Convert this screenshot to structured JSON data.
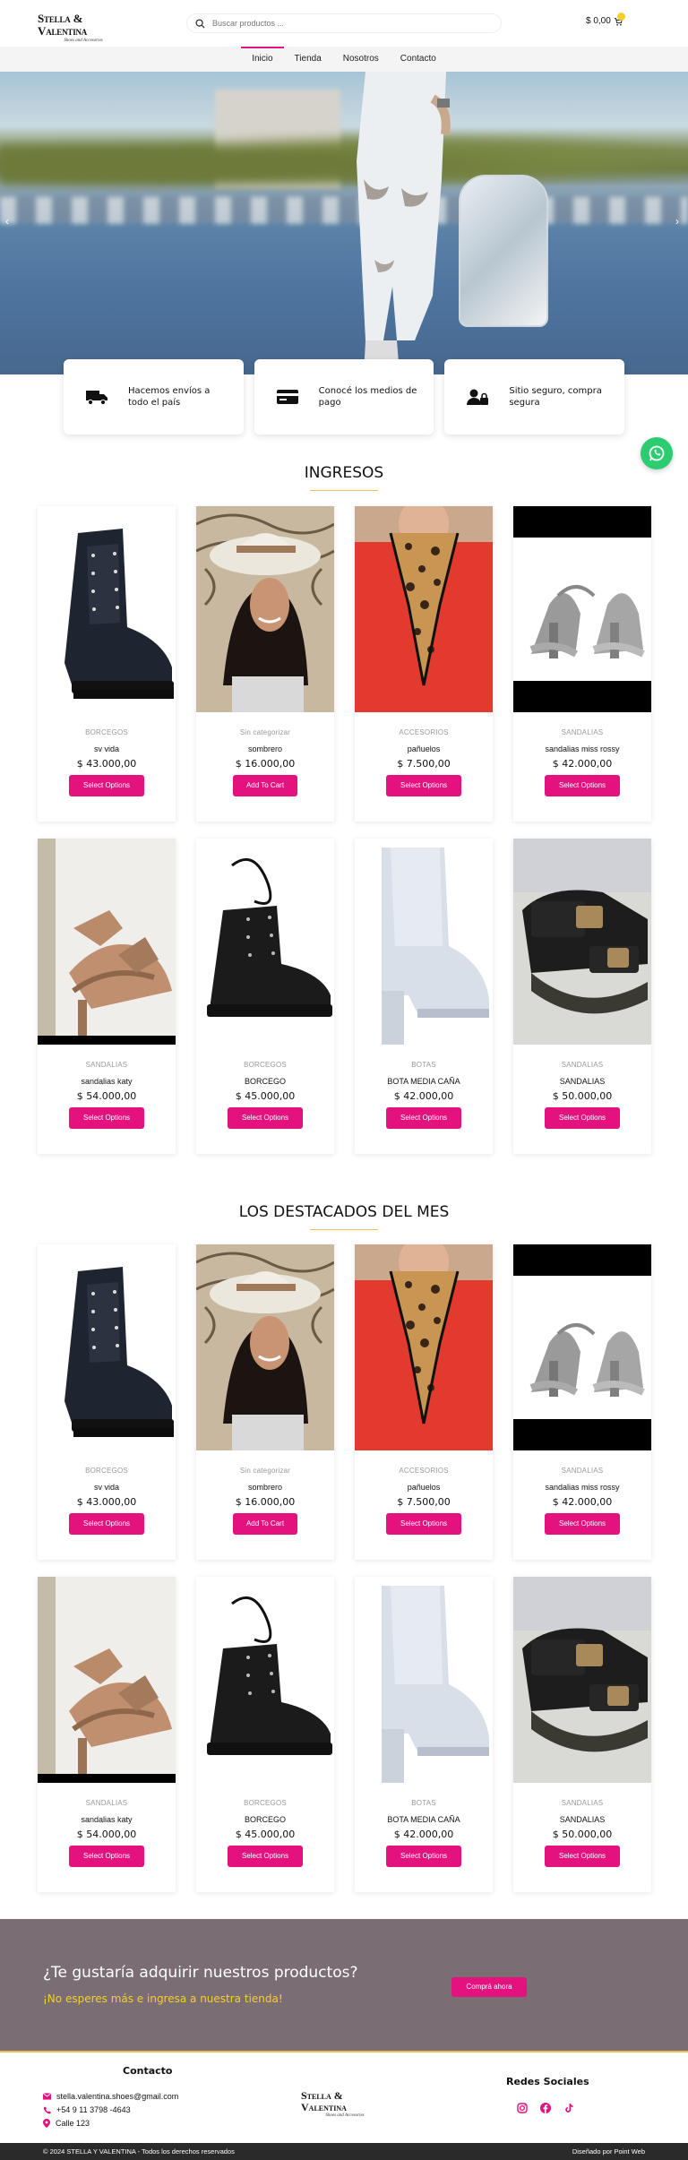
{
  "header": {
    "logo_line1": "Stella & Valentina",
    "logo_line2": "Shoes and Accesories",
    "search_placeholder": "Buscar productos ...",
    "cart_total": "$ 0,00"
  },
  "nav": {
    "items": [
      {
        "label": "Inicio",
        "active": true
      },
      {
        "label": "Tienda",
        "active": false
      },
      {
        "label": "Nosotros",
        "active": false
      },
      {
        "label": "Contacto",
        "active": false
      }
    ]
  },
  "features": [
    {
      "icon": "truck-icon",
      "text": "Hacemos envíos a todo el país"
    },
    {
      "icon": "credit-card-icon",
      "text": "Conocé los medios de pago"
    },
    {
      "icon": "user-lock-icon",
      "text": "Sitio seguro, compra segura"
    }
  ],
  "sections": [
    {
      "title": "INGRESOS",
      "products": [
        {
          "category": "BORCEGOS",
          "name": "sv vida",
          "price": "$ 43.000,00",
          "button": "Select Options"
        },
        {
          "category": "Sin categorizar",
          "name": "sombrero",
          "price": "$ 16.000,00",
          "button": "Add To Cart"
        },
        {
          "category": "ACCESORIOS",
          "name": "pañuelos",
          "price": "$ 7.500,00",
          "button": "Select Options"
        },
        {
          "category": "SANDALIAS",
          "name": "sandalias miss rossy",
          "price": "$ 42.000,00",
          "button": "Select Options"
        },
        {
          "category": "SANDALIAS",
          "name": "sandalias katy",
          "price": "$ 54.000,00",
          "button": "Select Options"
        },
        {
          "category": "BORCEGOS",
          "name": "BORCEGO",
          "price": "$ 45.000,00",
          "button": "Select Options"
        },
        {
          "category": "BOTAS",
          "name": "BOTA MEDIA CAÑA",
          "price": "$ 42.000,00",
          "button": "Select Options"
        },
        {
          "category": "SANDALIAS",
          "name": "SANDALIAS",
          "price": "$ 50.000,00",
          "button": "Select Options"
        }
      ]
    },
    {
      "title": "LOS DESTACADOS DEL MES",
      "products": [
        {
          "category": "BORCEGOS",
          "name": "sv vida",
          "price": "$ 43.000,00",
          "button": "Select Options"
        },
        {
          "category": "Sin categorizar",
          "name": "sombrero",
          "price": "$ 16.000,00",
          "button": "Add To Cart"
        },
        {
          "category": "ACCESORIOS",
          "name": "pañuelos",
          "price": "$ 7.500,00",
          "button": "Select Options"
        },
        {
          "category": "SANDALIAS",
          "name": "sandalias miss rossy",
          "price": "$ 42.000,00",
          "button": "Select Options"
        },
        {
          "category": "SANDALIAS",
          "name": "sandalias katy",
          "price": "$ 54.000,00",
          "button": "Select Options"
        },
        {
          "category": "BORCEGOS",
          "name": "BORCEGO",
          "price": "$ 45.000,00",
          "button": "Select Options"
        },
        {
          "category": "BOTAS",
          "name": "BOTA MEDIA CAÑA",
          "price": "$ 42.000,00",
          "button": "Select Options"
        },
        {
          "category": "SANDALIAS",
          "name": "SANDALIAS",
          "price": "$ 50.000,00",
          "button": "Select Options"
        }
      ]
    }
  ],
  "cta": {
    "title": "¿Te gustaría adquirir nuestros productos?",
    "subtitle": "¡No esperes más e ingresa a nuestra tienda!",
    "button": "Comprá ahora"
  },
  "footer": {
    "contact_title": "Contacto",
    "email": "stella.valentina.shoes@gmail.com",
    "phone": "+54 9 11 3798 -4643",
    "address": "Calle 123",
    "social_title": "Redes Sociales",
    "socials": [
      "instagram-icon",
      "facebook-icon",
      "tiktok-icon"
    ],
    "copyright": "© 2024 STELLA Y VALENTINA - Todos los derechos reservados",
    "credit": "Diseñado por Point Web"
  },
  "colors": {
    "accent": "#e4127f",
    "gold": "#e5c05a",
    "cta_bg": "#7a6d73",
    "whatsapp": "#2ecc71"
  }
}
